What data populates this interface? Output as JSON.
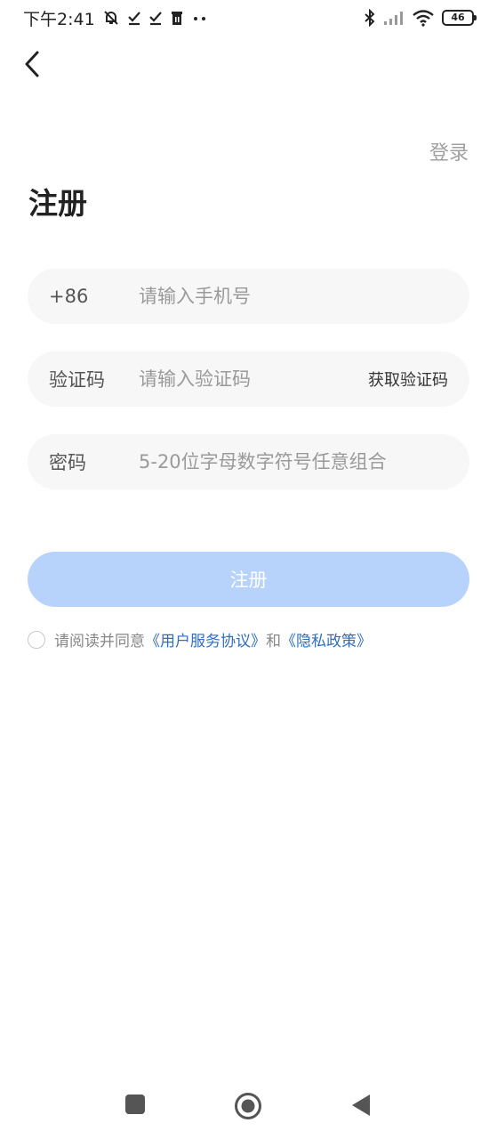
{
  "status_bar": {
    "time": "下午2:41",
    "battery": "46"
  },
  "header": {
    "login_link": "登录",
    "title": "注册"
  },
  "form": {
    "phone": {
      "label": "+86",
      "placeholder": "请输入手机号"
    },
    "code": {
      "label": "验证码",
      "placeholder": "请输入验证码",
      "get_code": "获取验证码"
    },
    "password": {
      "label": "密码",
      "placeholder": "5-20位字母数字符号任意组合"
    },
    "submit_label": "注册"
  },
  "agreement": {
    "prefix": "请阅读并同意",
    "service_link": "《用户服务协议》",
    "conjunction": "和",
    "privacy_link": "《隐私政策》"
  },
  "colors": {
    "primary_disabled": "#b8d3fb",
    "link": "#2f6fbf",
    "field_bg": "#f7f7f7"
  }
}
